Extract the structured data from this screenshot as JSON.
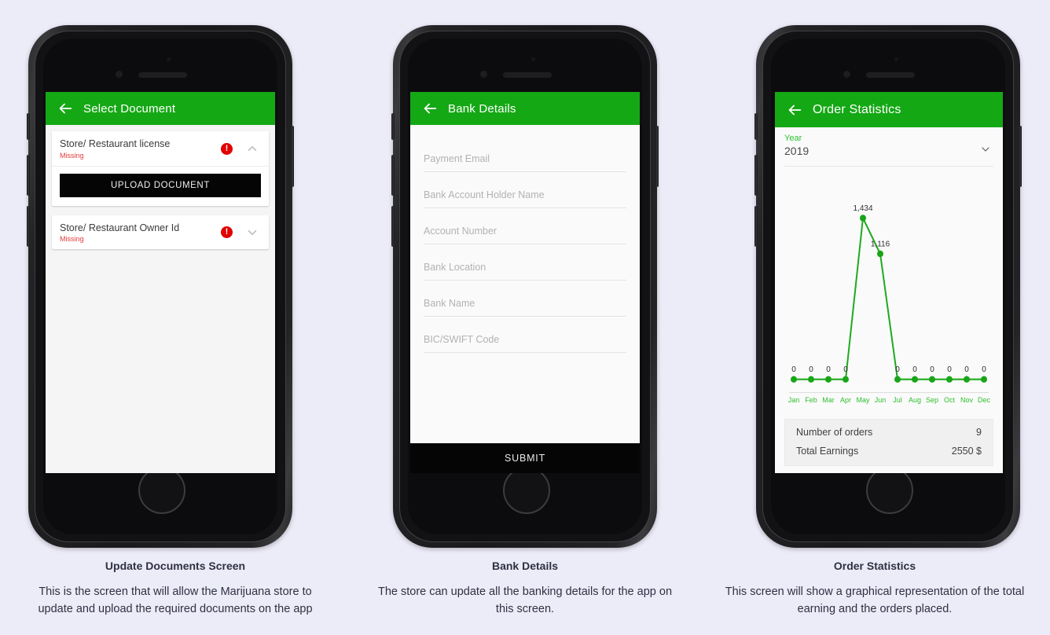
{
  "background_color": "#ecebf8",
  "accent_green": "#15a815",
  "alert_red": "#e00000",
  "phones": [
    {
      "appbar": {
        "title": "Select Document",
        "back_icon": "arrow-left-icon"
      },
      "documents": [
        {
          "title": "Store/ Restaurant license",
          "status": "Missing",
          "alert_icon": "exclamation-circle-icon",
          "chevron": "chevron-up-icon",
          "expanded": true,
          "upload_label": "UPLOAD DOCUMENT"
        },
        {
          "title": "Store/ Restaurant Owner Id",
          "status": "Missing",
          "alert_icon": "exclamation-circle-icon",
          "chevron": "chevron-down-icon",
          "expanded": false
        }
      ]
    },
    {
      "appbar": {
        "title": "Bank Details",
        "back_icon": "arrow-left-icon"
      },
      "fields": [
        {
          "placeholder": "Payment Email",
          "value": ""
        },
        {
          "placeholder": "Bank Account Holder Name",
          "value": ""
        },
        {
          "placeholder": "Account Number",
          "value": ""
        },
        {
          "placeholder": "Bank Location",
          "value": ""
        },
        {
          "placeholder": "Bank Name",
          "value": ""
        },
        {
          "placeholder": "BIC/SWIFT Code",
          "value": ""
        }
      ],
      "submit_label": "SUBMIT"
    },
    {
      "appbar": {
        "title": "Order Statistics",
        "back_icon": "arrow-left-icon"
      },
      "year_picker": {
        "label": "Year",
        "value": "2019",
        "chevron": "chevron-down-icon"
      },
      "stats": [
        {
          "label": "Number of orders",
          "value": "9"
        },
        {
          "label": "Total Earnings",
          "value": "2550 $"
        }
      ]
    }
  ],
  "chart_data": {
    "type": "line",
    "title": "",
    "xlabel": "",
    "ylabel": "",
    "categories": [
      "Jan",
      "Feb",
      "Mar",
      "Apr",
      "May",
      "Jun",
      "Jul",
      "Aug",
      "Sep",
      "Oct",
      "Nov",
      "Dec"
    ],
    "values": [
      0,
      0,
      0,
      0,
      1434,
      1116,
      0,
      0,
      0,
      0,
      0,
      0
    ],
    "point_labels": [
      "0",
      "0",
      "0",
      "0",
      "1,434",
      "1,116",
      "0",
      "0",
      "0",
      "0",
      "0",
      "0"
    ],
    "ylim": [
      0,
      1600
    ],
    "grid": false,
    "legend": "none",
    "line_color": "#1faa1f",
    "point_color": "#18a518",
    "label_color": "#2e2e2e",
    "tick_color": "#2fbf2f"
  },
  "captions": [
    {
      "title": "Update Documents Screen",
      "text": "This is the screen that will allow the Marijuana store to update and upload the required documents on the app"
    },
    {
      "title": "Bank Details",
      "text": "The store can update all the banking details for the app on this screen."
    },
    {
      "title": "Order Statistics",
      "text": "This screen will show a graphical representation of the total earning and the orders placed."
    }
  ]
}
